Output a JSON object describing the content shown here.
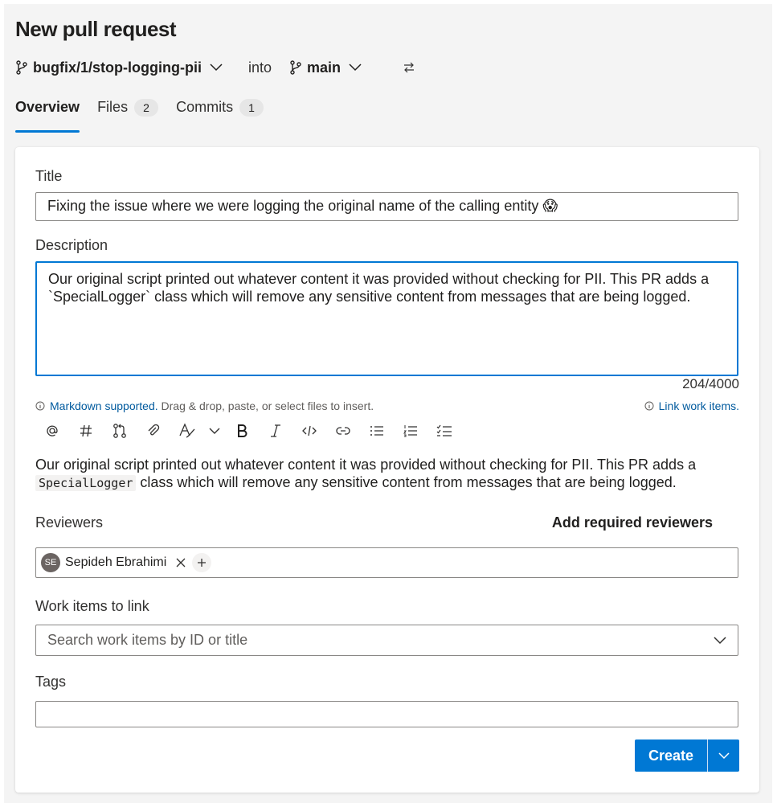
{
  "page": {
    "title": "New pull request"
  },
  "branches": {
    "source": "bugfix/1/stop-logging-pii",
    "into_label": "into",
    "target": "main"
  },
  "tabs": [
    {
      "label": "Overview",
      "badge": ""
    },
    {
      "label": "Files",
      "badge": "2"
    },
    {
      "label": "Commits",
      "badge": "1"
    }
  ],
  "form": {
    "title_label": "Title",
    "title_value": "Fixing the issue where we were logging the original name of the calling entity 😱",
    "description_label": "Description",
    "description_value": "Our original script printed out whatever content it was provided without checking for PII. This PR adds a `SpecialLogger` class which will remove any sensitive content from messages that are being logged.",
    "char_count": "204/4000",
    "markdown_link": "Markdown supported.",
    "markdown_hint": "Drag & drop, paste, or select files to insert.",
    "link_work_items": "Link work items.",
    "toolbar": [
      "mention-icon",
      "hashtag-icon",
      "pull-request-icon",
      "attach-icon",
      "format-text-icon",
      "chevron-down-icon",
      "bold-icon",
      "italic-icon",
      "code-icon",
      "link-icon",
      "bulleted-list-icon",
      "numbered-list-icon",
      "task-list-icon"
    ],
    "preview": {
      "part1": "Our original script printed out whatever content it was provided without checking for PII. This PR adds a",
      "code": "SpecialLogger",
      "part2": "class which will remove any sensitive content from messages that are being logged."
    },
    "reviewers_label": "Reviewers",
    "add_required_reviewers": "Add required reviewers",
    "reviewer": {
      "initials": "SE",
      "name": "Sepideh Ebrahimi"
    },
    "work_items_label": "Work items to link",
    "work_items_placeholder": "Search work items by ID or title",
    "tags_label": "Tags",
    "tags_value": "",
    "create_label": "Create"
  },
  "colors": {
    "accent": "#0078d4",
    "link": "#005a9e",
    "avatar": "#6b6462"
  }
}
